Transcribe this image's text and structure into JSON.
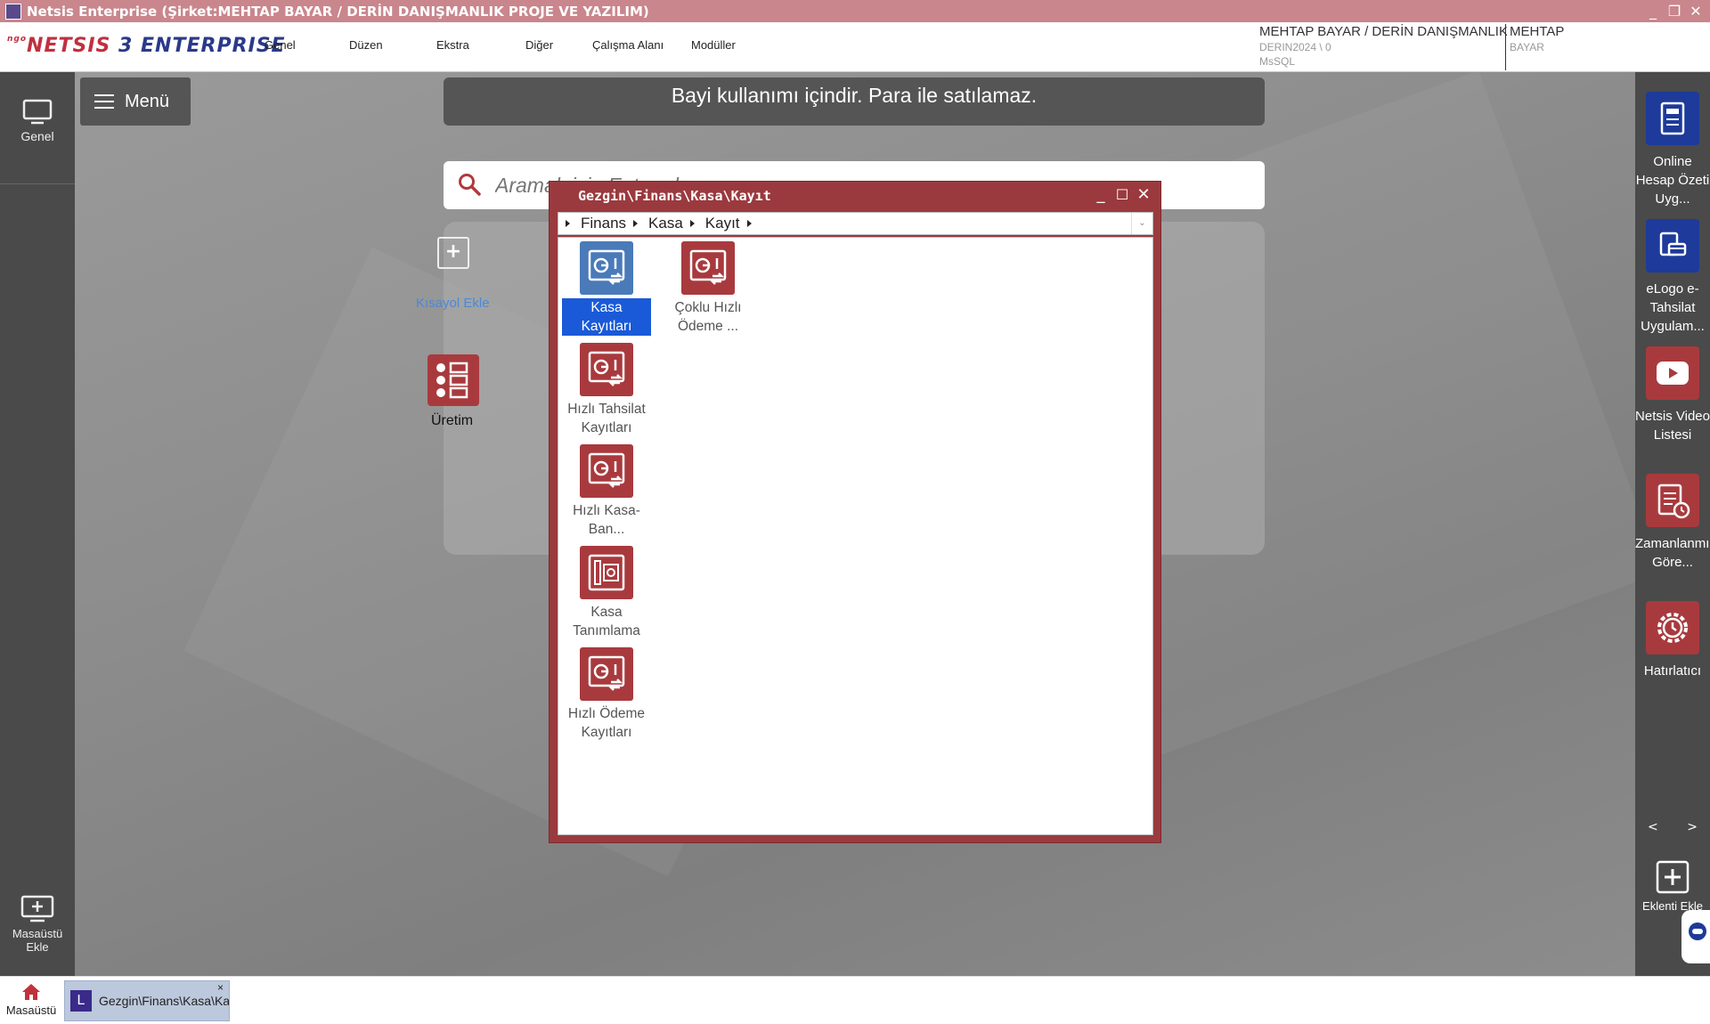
{
  "window": {
    "title": "Netsis Enterprise (Şirket:MEHTAP BAYAR / DERİN DANIŞMANLIK PROJE VE YAZILIM)"
  },
  "logo": {
    "small": "ngo",
    "main": "NETSIS",
    "three": "3",
    "ent": "ENTERPRISE"
  },
  "menubar": {
    "items": [
      "Genel",
      "Düzen",
      "Ekstra",
      "Diğer",
      "Çalışma Alanı",
      "Modüller"
    ]
  },
  "company": {
    "name": "MEHTAP BAYAR / DERİN DANIŞMANLIK",
    "db": "DERIN2024 \\ 0",
    "server": "MsSQL"
  },
  "user": {
    "first": "MEHTAP",
    "last": "BAYAR"
  },
  "leftbar": {
    "genel": "Genel",
    "add_desktop": "Masaüstü Ekle"
  },
  "desktop": {
    "menu_label": "Menü",
    "banner": "Bayi kullanımı içindir. Para ile satılamaz.",
    "search_placeholder": "Aramak için Entere basın",
    "shortcut_label": "Kısayol Ekle",
    "uretim_label": "Üretim"
  },
  "rightbar": {
    "items": [
      "Online Hesap Özeti Uyg...",
      "eLogo e-Tahsilat Uygulam...",
      "Netsis Video Listesi",
      "Zamanlanmış Göre...",
      "Hatırlatıcı"
    ],
    "nav_prev": "<",
    "nav_next": ">",
    "add_plugin": "Eklenti Ekle"
  },
  "dialog": {
    "title": "Gezgin\\Finans\\Kasa\\Kayıt",
    "breadcrumb": [
      "Finans",
      "Kasa",
      "Kayıt"
    ],
    "items": [
      {
        "label": "Kasa Kayıtları",
        "selected": true
      },
      {
        "label": "Çoklu Hızlı Ödeme ..."
      },
      {
        "label": "Hızlı Tahsilat Kayıtları"
      },
      {
        "label": "Hızlı Kasa-Ban..."
      },
      {
        "label": "Kasa Tanımlama"
      },
      {
        "label": "Hızlı Ödeme Kayıtları"
      }
    ]
  },
  "taskbar": {
    "home": "Masaüstü",
    "task": "Gezgin\\Finans\\Kasa\\Kayıt",
    "task_close": "×"
  },
  "colors": {
    "title_bar": "#c9868c",
    "dialog_frame": "#9a3a3e",
    "icon_red": "#a83a3e",
    "icon_blue": "#1e3a9a",
    "selection": "#1a5ad8"
  }
}
